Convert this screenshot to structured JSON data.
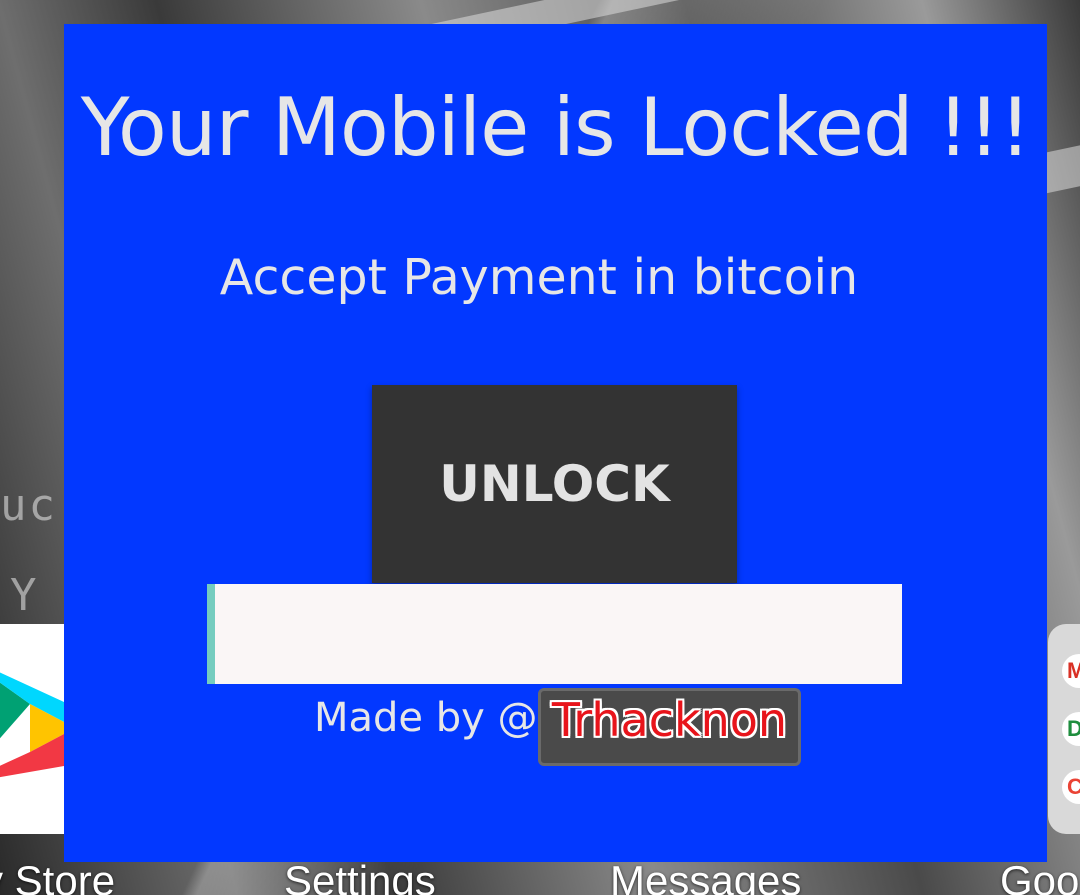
{
  "overlay": {
    "title": "Your Mobile is Locked !!!",
    "subtitle": "Accept Payment in bitcoin",
    "unlock_button_label": "UNLOCK",
    "key_input_value": "",
    "credit_text": "Made by @",
    "background_color": "#0238ff",
    "button_color": "#333333",
    "input_accent_color": "#75ccbf"
  },
  "watermark": {
    "text": "Trhacknon",
    "text_color": "#e8141b"
  },
  "home_screen": {
    "app_labels": [
      "y Store",
      "Settings",
      "Messages",
      "Goo"
    ],
    "left_app_icon": "play-store-icon",
    "folder_icons": [
      "gmail-icon",
      "google-drive-icon",
      "chrome-icon"
    ]
  }
}
